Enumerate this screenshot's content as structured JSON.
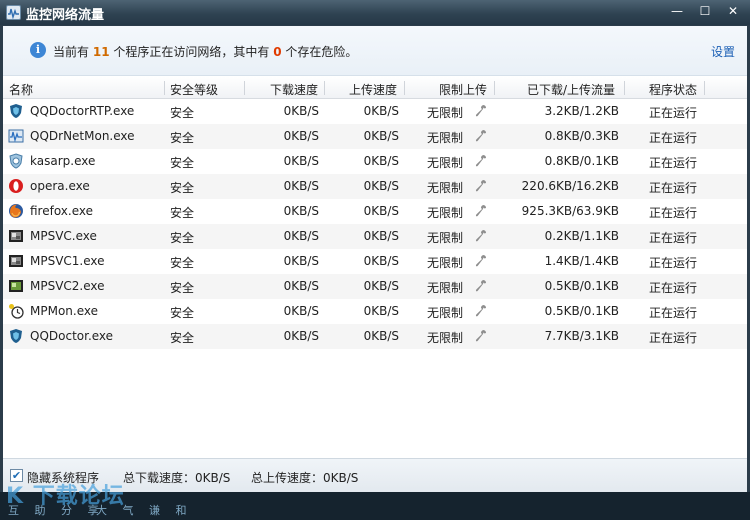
{
  "window": {
    "title": "监控网络流量",
    "icon": "network-monitor-icon",
    "controls": {
      "minimize": "—",
      "maximize": "☐",
      "close": "✕"
    }
  },
  "info": {
    "prefix": "当前有",
    "program_count": "11",
    "middle": "个程序正在访问网络，其中有",
    "danger_count": "0",
    "suffix": "个存在危险。",
    "settings_label": "设置"
  },
  "table": {
    "columns": [
      "名称",
      "安全等级",
      "下载速度",
      "上传速度",
      "限制上传",
      "已下载/上传流量",
      "程序状态"
    ],
    "rows": [
      {
        "icon": "shield-blue-icon",
        "name": "QQDoctorRTP.exe",
        "security": "安全",
        "download": "0KB/S",
        "upload": "0KB/S",
        "limit": "无限制",
        "traffic": "3.2KB/1.2KB",
        "status": "正在运行"
      },
      {
        "icon": "monitor-wave-icon",
        "name": "QQDrNetMon.exe",
        "security": "安全",
        "download": "0KB/S",
        "upload": "0KB/S",
        "limit": "无限制",
        "traffic": "0.8KB/0.3KB",
        "status": "正在运行"
      },
      {
        "icon": "shield-light-icon",
        "name": "kasarp.exe",
        "security": "安全",
        "download": "0KB/S",
        "upload": "0KB/S",
        "limit": "无限制",
        "traffic": "0.8KB/0.1KB",
        "status": "正在运行"
      },
      {
        "icon": "opera-icon",
        "name": "opera.exe",
        "security": "安全",
        "download": "0KB/S",
        "upload": "0KB/S",
        "limit": "无限制",
        "traffic": "220.6KB/16.2KB",
        "status": "正在运行"
      },
      {
        "icon": "firefox-icon",
        "name": "firefox.exe",
        "security": "安全",
        "download": "0KB/S",
        "upload": "0KB/S",
        "limit": "无限制",
        "traffic": "925.3KB/63.9KB",
        "status": "正在运行"
      },
      {
        "icon": "film-icon",
        "name": "MPSVC.exe",
        "security": "安全",
        "download": "0KB/S",
        "upload": "0KB/S",
        "limit": "无限制",
        "traffic": "0.2KB/1.1KB",
        "status": "正在运行"
      },
      {
        "icon": "film-icon",
        "name": "MPSVC1.exe",
        "security": "安全",
        "download": "0KB/S",
        "upload": "0KB/S",
        "limit": "无限制",
        "traffic": "1.4KB/1.4KB",
        "status": "正在运行"
      },
      {
        "icon": "film-green-icon",
        "name": "MPSVC2.exe",
        "security": "安全",
        "download": "0KB/S",
        "upload": "0KB/S",
        "limit": "无限制",
        "traffic": "0.5KB/0.1KB",
        "status": "正在运行"
      },
      {
        "icon": "clock-key-icon",
        "name": "MPMon.exe",
        "security": "安全",
        "download": "0KB/S",
        "upload": "0KB/S",
        "limit": "无限制",
        "traffic": "0.5KB/0.1KB",
        "status": "正在运行"
      },
      {
        "icon": "shield-blue-icon",
        "name": "QQDoctor.exe",
        "security": "安全",
        "download": "0KB/S",
        "upload": "0KB/S",
        "limit": "无限制",
        "traffic": "7.7KB/3.1KB",
        "status": "正在运行"
      }
    ]
  },
  "footer": {
    "hide_system_label": "隐藏系统程序",
    "hide_system_checked": true,
    "total_download": "总下载速度：0KB/S",
    "total_upload": "总上传速度：0KB/S"
  },
  "watermark": {
    "logo": "K 下载论坛",
    "left": "互 助 分 享",
    "right": "大 气 谦 和"
  },
  "colors": {
    "accent": "#1b5fb5",
    "program_count": "#d06a00",
    "danger_count": "#e03b00"
  }
}
